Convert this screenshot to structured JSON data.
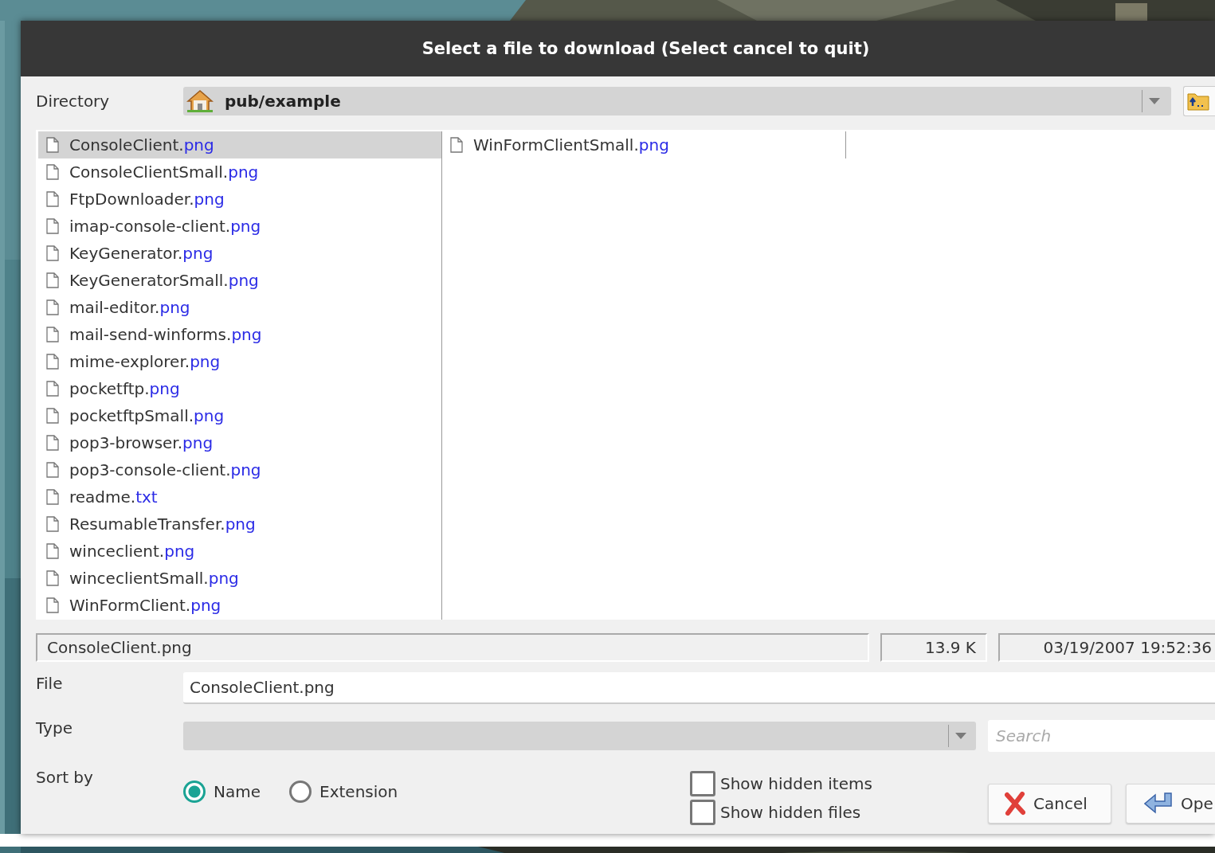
{
  "window": {
    "title": "Select a file to download (Select cancel to quit)"
  },
  "directory": {
    "label": "Directory",
    "value": "pub/example"
  },
  "files": [
    {
      "name": "ConsoleClient.",
      "ext": "png",
      "selected": true
    },
    {
      "name": "ConsoleClientSmall.",
      "ext": "png",
      "selected": false
    },
    {
      "name": "FtpDownloader.",
      "ext": "png",
      "selected": false
    },
    {
      "name": "imap-console-client.",
      "ext": "png",
      "selected": false
    },
    {
      "name": "KeyGenerator.",
      "ext": "png",
      "selected": false
    },
    {
      "name": "KeyGeneratorSmall.",
      "ext": "png",
      "selected": false
    },
    {
      "name": "mail-editor.",
      "ext": "png",
      "selected": false
    },
    {
      "name": "mail-send-winforms.",
      "ext": "png",
      "selected": false
    },
    {
      "name": "mime-explorer.",
      "ext": "png",
      "selected": false
    },
    {
      "name": "pocketftp.",
      "ext": "png",
      "selected": false
    },
    {
      "name": "pocketftpSmall.",
      "ext": "png",
      "selected": false
    },
    {
      "name": "pop3-browser.",
      "ext": "png",
      "selected": false
    },
    {
      "name": "pop3-console-client.",
      "ext": "png",
      "selected": false
    },
    {
      "name": "readme.",
      "ext": "txt",
      "selected": false
    },
    {
      "name": "ResumableTransfer.",
      "ext": "png",
      "selected": false
    },
    {
      "name": "winceclient.",
      "ext": "png",
      "selected": false
    },
    {
      "name": "winceclientSmall.",
      "ext": "png",
      "selected": false
    },
    {
      "name": "WinFormClient.",
      "ext": "png",
      "selected": false
    },
    {
      "name": "WinFormClientSmall.",
      "ext": "png",
      "selected": false
    }
  ],
  "status": {
    "name": "ConsoleClient.png",
    "size": "13.9 K",
    "modified": "03/19/2007 19:52:36"
  },
  "file": {
    "label": "File",
    "value": "ConsoleClient.png"
  },
  "type": {
    "label": "Type"
  },
  "search": {
    "placeholder": "Search"
  },
  "sort": {
    "label": "Sort by",
    "options": [
      {
        "label": "Name",
        "selected": true
      },
      {
        "label": "Extension",
        "selected": false
      }
    ]
  },
  "options": [
    {
      "label": "Show hidden items",
      "checked": false
    },
    {
      "label": "Show hidden files",
      "checked": false
    }
  ],
  "buttons": [
    {
      "label": "Cancel",
      "kind": "cancel"
    },
    {
      "label": "Ope",
      "kind": "open"
    }
  ]
}
